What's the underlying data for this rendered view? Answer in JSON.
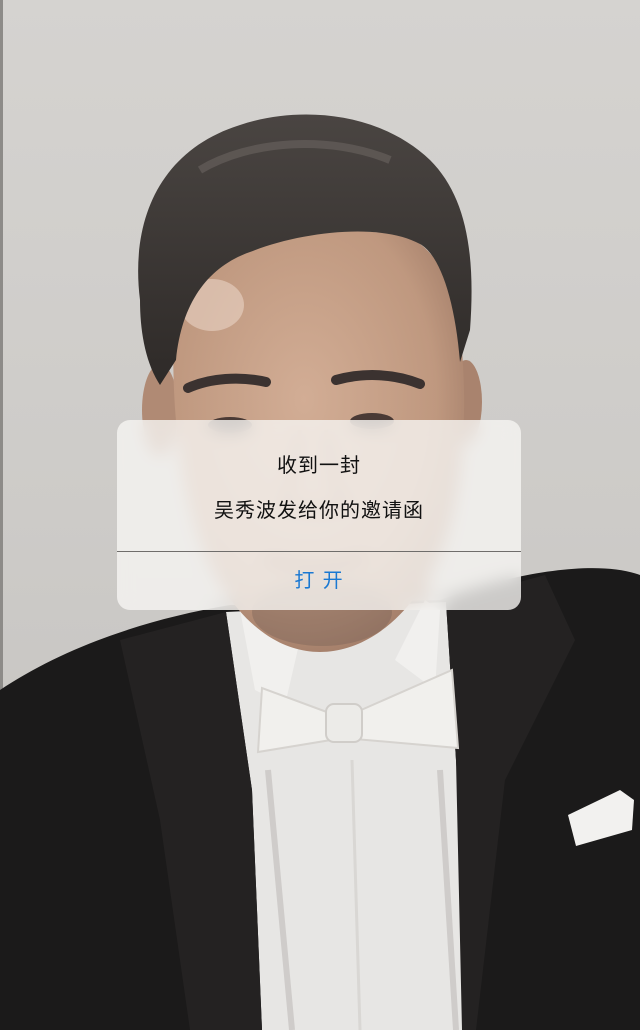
{
  "alert": {
    "title": "收到一封",
    "message": "吴秀波发给你的邀请函",
    "button_label": "打 开"
  },
  "colors": {
    "accent": "#1a78d2",
    "alert_background": "#f6f5f3",
    "background_wall": "#cfcdca",
    "jacket": "#1b1a1a"
  }
}
